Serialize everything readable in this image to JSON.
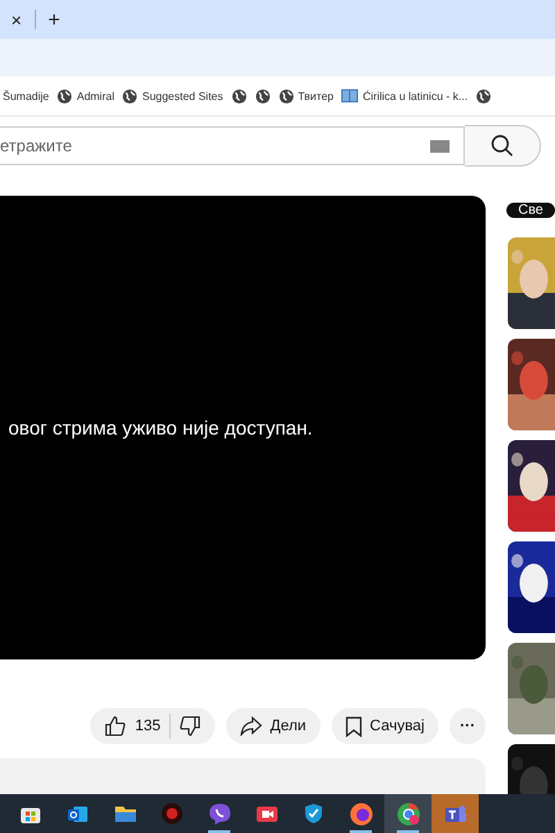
{
  "tab_strip": {
    "close": "×",
    "new_tab": "+"
  },
  "bookmarks": [
    {
      "label": "Šumadije",
      "kind": "plain"
    },
    {
      "label": "Admiral",
      "kind": "site"
    },
    {
      "label": "Suggested Sites",
      "kind": "site"
    },
    {
      "kind": "site"
    },
    {
      "kind": "site"
    },
    {
      "label": "Твитер",
      "kind": "site"
    },
    {
      "label": "Ćirilica u latinicu - k...",
      "kind": "page"
    },
    {
      "kind": "site"
    }
  ],
  "search": {
    "placeholder": "етражите"
  },
  "player": {
    "message": "овог стрима уживо није доступан."
  },
  "actions": {
    "likes": "135",
    "share": "Дели",
    "save": "Сачувај",
    "more": "···"
  },
  "chips": [
    {
      "label": "Све",
      "selected": true
    }
  ],
  "taskbar": [
    {
      "kind": "store",
      "running": false,
      "active": false,
      "attention": false
    },
    {
      "kind": "mail",
      "running": false,
      "active": false,
      "attention": false
    },
    {
      "kind": "folder",
      "running": false,
      "active": false,
      "attention": false
    },
    {
      "kind": "record",
      "running": false,
      "active": false,
      "attention": false
    },
    {
      "kind": "chat",
      "running": true,
      "active": false,
      "attention": false
    },
    {
      "kind": "camera",
      "running": false,
      "active": false,
      "attention": false
    },
    {
      "kind": "shield",
      "running": false,
      "active": false,
      "attention": false
    },
    {
      "kind": "fox",
      "running": true,
      "active": false,
      "attention": false
    },
    {
      "kind": "browser",
      "running": true,
      "active": true,
      "attention": false
    },
    {
      "kind": "teams",
      "running": false,
      "active": false,
      "attention": true
    }
  ]
}
